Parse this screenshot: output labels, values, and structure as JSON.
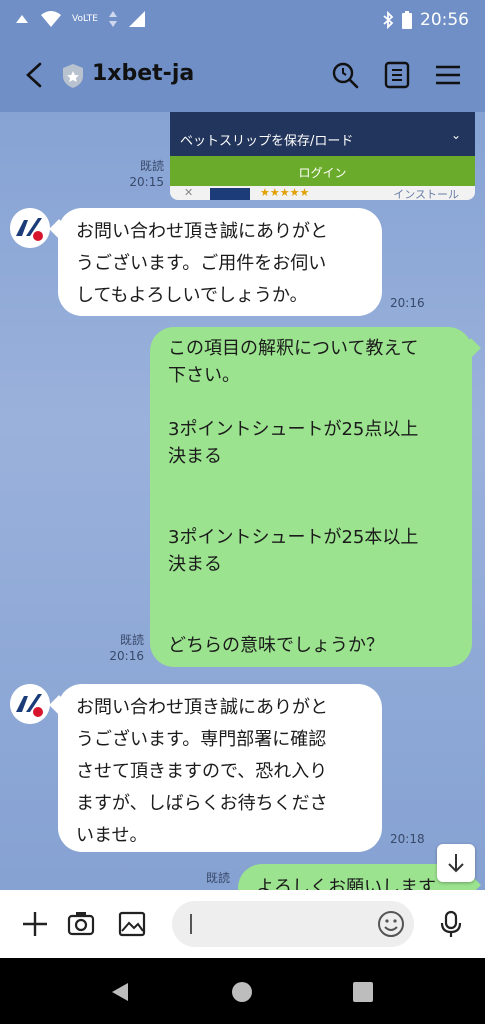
{
  "status_bar": {
    "time": "20:56",
    "icons": [
      "wifi-data-icon",
      "wifi-icon",
      "volte-icon",
      "data-arrows-icon",
      "signal-icon",
      "bluetooth-icon",
      "battery-icon"
    ],
    "volte_text": "VoLTE"
  },
  "header": {
    "title": "1xbet-ja",
    "icons": [
      "back-icon",
      "shield-icon",
      "search-icon",
      "notes-icon",
      "menu-icon"
    ],
    "background": "#6f8fc6"
  },
  "chat": {
    "preview_card": {
      "dropdown_text": "ベットスリップを保存/ロード",
      "login_text": "ログイン",
      "install_text": "インストール",
      "stars": "★★★★★"
    },
    "messages": [
      {
        "side": "me",
        "read": "既読",
        "time": "20:15",
        "type": "image-preview"
      },
      {
        "side": "them",
        "avatar": "1x",
        "time": "20:16",
        "lines": [
          "お問い合わせ頂き誠にありがと",
          "うございます。ご用件をお伺い",
          "してもよろしいでしょうか。"
        ]
      },
      {
        "side": "me",
        "read": "既読",
        "time": "20:16",
        "lines": [
          "この項目の解釈について教えて",
          "下さい。",
          "",
          "3ポイントシュートが25点以上",
          "決まる",
          "",
          "",
          "3ポイントシュートが25本以上",
          "決まる",
          "",
          "",
          "どちらの意味でしょうか？"
        ]
      },
      {
        "side": "them",
        "avatar": "1x",
        "time": "20:18",
        "lines": [
          "お問い合わせ頂き誠にありがと",
          "うございます。専門部署に確認",
          "させて頂きますので、恐れ入り",
          "ますが、しばらくお待ちくださ",
          "いませ。"
        ]
      },
      {
        "side": "me",
        "read": "既読",
        "time": "",
        "lines": [
          "よろしくお願いします"
        ]
      }
    ],
    "colors": {
      "my_bubble": "#9be38e",
      "their_bubble": "#ffffff"
    }
  },
  "input_bar": {
    "icons": [
      "plus-icon",
      "camera-icon",
      "image-icon",
      "emoji-icon",
      "microphone-icon"
    ],
    "value": "",
    "placeholder": ""
  },
  "nav_bar": {
    "icons": [
      "back-triangle-icon",
      "home-circle-icon",
      "recents-square-icon"
    ]
  }
}
